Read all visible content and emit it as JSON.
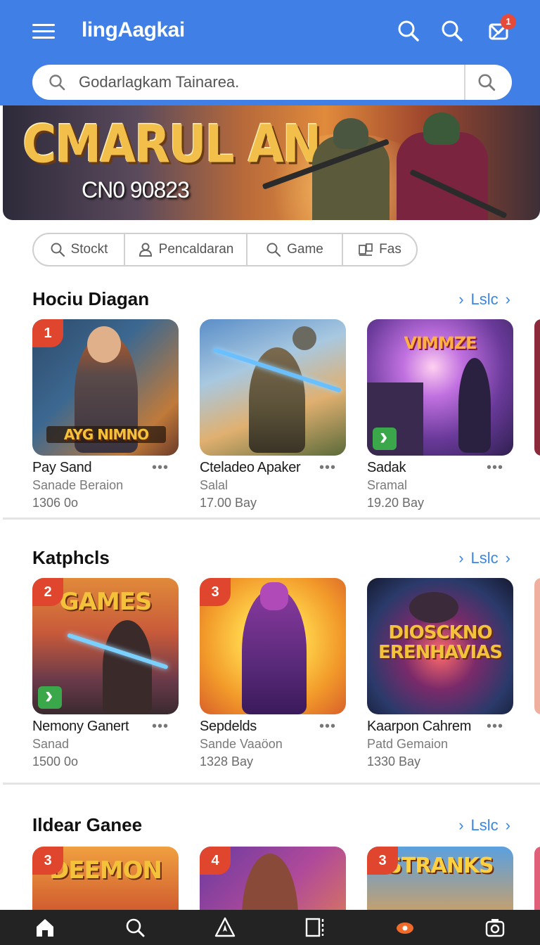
{
  "header": {
    "app_title": "lingAagkai",
    "notification_count": "1",
    "search_placeholder": "Godarlagkam Tainarea."
  },
  "banner": {
    "title": "CMARUL AN",
    "subtitle": "CN0 90823"
  },
  "filters": [
    {
      "label": "Stockt",
      "icon": "search-icon"
    },
    {
      "label": "Pencaldaran",
      "icon": "person-icon"
    },
    {
      "label": "Game",
      "icon": "search-icon"
    },
    {
      "label": "Fas",
      "icon": "layers-icon"
    }
  ],
  "sections": [
    {
      "title": "Hociu Diagan",
      "see_all": "Lslc",
      "cards": [
        {
          "rank": "1",
          "thumb_text": "AYG NIMNO",
          "name": "Pay  Sand",
          "sub": "Sanade Beraion",
          "meta": "1306 0o"
        },
        {
          "rank": "",
          "thumb_text": "",
          "name": "Cteladeo Apaker",
          "sub": "Salal",
          "meta": "17.00 Bay"
        },
        {
          "rank": "",
          "thumb_text": "VIMMZE",
          "name": "Sadak",
          "sub": "Sramal",
          "meta": "19.20 Bay"
        }
      ]
    },
    {
      "title": "Katphcls",
      "see_all": "Lslc",
      "cards": [
        {
          "rank": "2",
          "thumb_text": "GAMES",
          "name": "Nemony Ganert",
          "sub": "Sanad",
          "meta": "1500 0o"
        },
        {
          "rank": "3",
          "thumb_text": "",
          "name": "Sepdelds",
          "sub": "Sande Vaaöon",
          "meta": "1328 Bay"
        },
        {
          "rank": "",
          "thumb_text": "DIOSCKNO ERENHAVIAS",
          "name": "Kaarpon Cahrem",
          "sub": "Patd Gemaion",
          "meta": "1330 Bay"
        }
      ]
    },
    {
      "title": "Ildear Ganee",
      "see_all": "Lslc",
      "cards": [
        {
          "rank": "3",
          "thumb_text": "DEEMON"
        },
        {
          "rank": "4",
          "thumb_text": ""
        },
        {
          "rank": "3",
          "thumb_text": "STRANKS"
        }
      ]
    }
  ],
  "more_label": "•••",
  "bottom_nav": [
    "home-icon",
    "search-icon",
    "compass-icon",
    "library-icon",
    "games-icon",
    "camera-icon"
  ],
  "colors": {
    "header": "#3f7fe6",
    "accent": "#3a86e0",
    "rank_badge": "#e0452e",
    "play_button": "#3aa84a",
    "nav": "#232323"
  }
}
